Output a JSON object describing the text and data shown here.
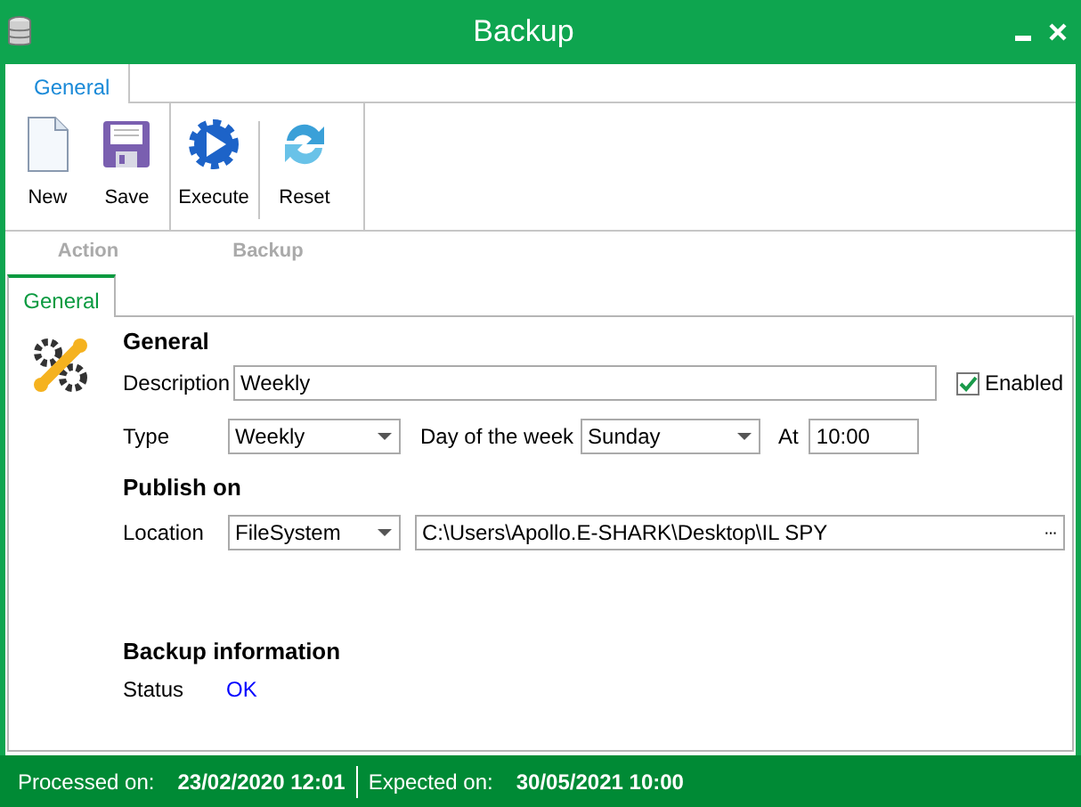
{
  "window": {
    "title": "Backup"
  },
  "ribbon": {
    "tabs": [
      {
        "label": "General",
        "selected": true
      }
    ],
    "groups": [
      {
        "label": "Action",
        "buttons": [
          {
            "label": "New",
            "kind": "new"
          },
          {
            "label": "Save",
            "kind": "save"
          }
        ]
      },
      {
        "label": "Backup",
        "buttons": [
          {
            "label": "Execute",
            "kind": "execute"
          },
          {
            "label": "Reset",
            "kind": "reset"
          }
        ]
      }
    ]
  },
  "page_tabs": [
    {
      "label": "General",
      "selected": true
    }
  ],
  "general": {
    "heading": "General",
    "description": {
      "label": "Description",
      "value": "Weekly"
    },
    "enabled": {
      "label": "Enabled",
      "checked": true
    },
    "type": {
      "label": "Type",
      "value": "Weekly"
    },
    "day_of_week": {
      "label": "Day of the week",
      "value": "Sunday"
    },
    "at": {
      "label": "At",
      "value": "10:00"
    }
  },
  "publish_on": {
    "heading": "Publish on",
    "location": {
      "label": "Location",
      "value": "FileSystem"
    },
    "path": {
      "value": "C:\\Users\\Apollo.E-SHARK\\Desktop\\IL SPY",
      "button": "···"
    }
  },
  "backup_information": {
    "heading": "Backup information",
    "status": {
      "label": "Status",
      "value": "OK"
    }
  },
  "status_bar": [
    {
      "label": "Processed on:",
      "value": "23/02/2020 12:01"
    },
    {
      "label": "Expected on:",
      "value": "30/05/2021 10:00"
    }
  ]
}
